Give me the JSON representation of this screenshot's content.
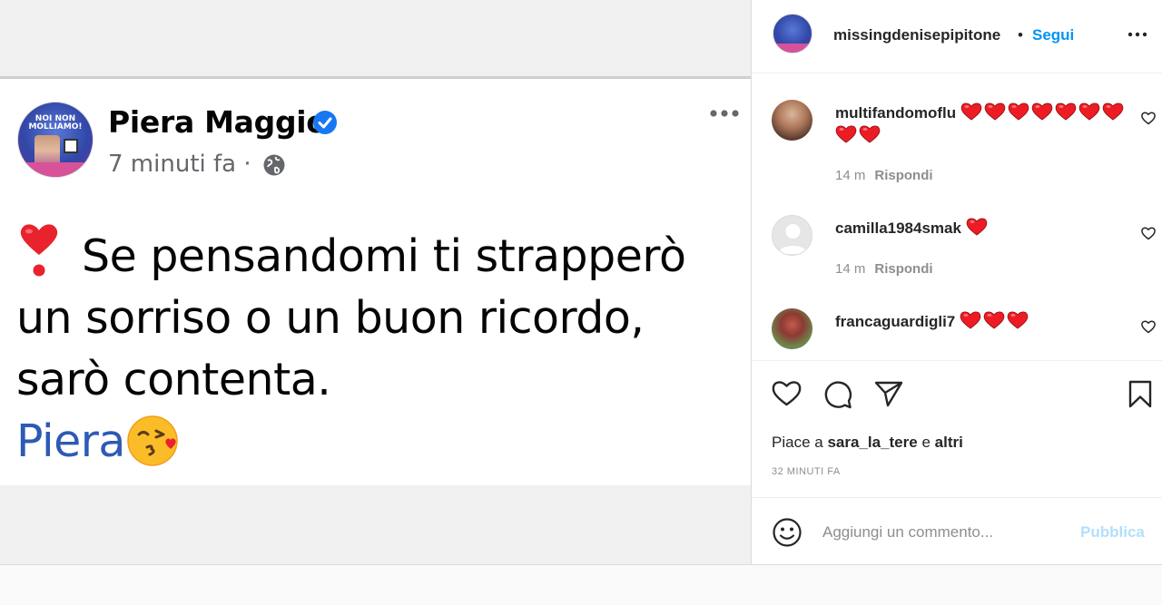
{
  "post_image": {
    "avatar_text": "NOI NON MOLLIAMO!",
    "author": "Piera Maggio",
    "time": "7 minuti fa ·",
    "text_line1": "Se pensandomi ti strapperò",
    "text_line2": "un sorriso o un buon ricordo,",
    "text_line3": "sarò contenta.",
    "signature": "Piera"
  },
  "header": {
    "username": "missingdenisepipitone",
    "separator": "•",
    "follow_label": "Segui"
  },
  "comments": [
    {
      "username": "multifandomoflu",
      "hearts": 9,
      "time": "14 m",
      "reply_label": "Rispondi"
    },
    {
      "username": "camilla1984smak",
      "hearts": 1,
      "time": "14 m",
      "reply_label": "Rispondi"
    },
    {
      "username": "francaguardigli7",
      "hearts": 3
    }
  ],
  "likes": {
    "prefix": "Piace a",
    "user": "sara_la_tere",
    "middle": "e",
    "others": "altri"
  },
  "date": "32 MINUTI FA",
  "comment_box": {
    "placeholder": "Aggiungi un commento...",
    "publish_label": "Pubblica"
  },
  "colors": {
    "accent_blue": "#0095f6",
    "publish_disabled": "#b2dffc",
    "heart_red": "#ed1c24",
    "fb_verified": "#1877f2"
  }
}
